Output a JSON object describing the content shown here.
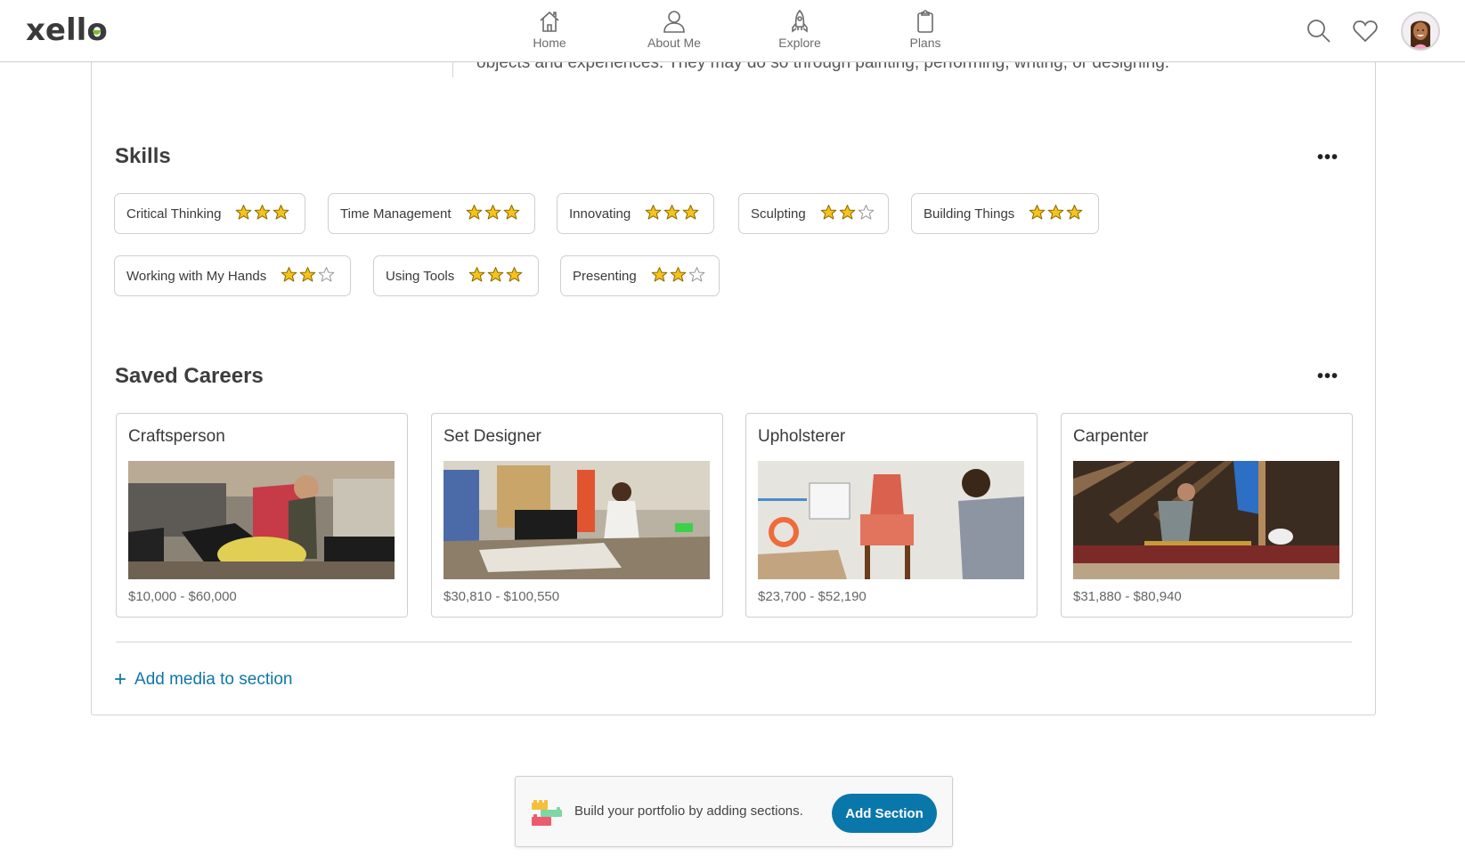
{
  "header": {
    "logo": "xello",
    "nav": [
      {
        "label": "Home",
        "icon": "home-icon"
      },
      {
        "label": "About Me",
        "icon": "person-icon"
      },
      {
        "label": "Explore",
        "icon": "rocket-icon"
      },
      {
        "label": "Plans",
        "icon": "clipboard-icon"
      }
    ],
    "actions": [
      "search-icon",
      "heart-icon",
      "avatar"
    ]
  },
  "about": {
    "text_fragment": "objects and experiences. They may do so through painting, performing, writing, or designing."
  },
  "skills": {
    "title": "Skills",
    "more_label": "•••",
    "items": [
      {
        "label": "Critical Thinking",
        "rating": 3,
        "max": 3
      },
      {
        "label": "Time Management",
        "rating": 3,
        "max": 3
      },
      {
        "label": "Innovating",
        "rating": 3,
        "max": 3
      },
      {
        "label": "Sculpting",
        "rating": 2,
        "max": 3
      },
      {
        "label": "Building Things",
        "rating": 3,
        "max": 3
      },
      {
        "label": "Working with My Hands",
        "rating": 2,
        "max": 3
      },
      {
        "label": "Using Tools",
        "rating": 3,
        "max": 3
      },
      {
        "label": "Presenting",
        "rating": 2,
        "max": 3
      }
    ]
  },
  "saved_careers": {
    "title": "Saved Careers",
    "more_label": "•••",
    "items": [
      {
        "title": "Craftsperson",
        "salary": "$10,000 - $60,000"
      },
      {
        "title": "Set Designer",
        "salary": "$30,810 - $100,550"
      },
      {
        "title": "Upholsterer",
        "salary": "$23,700 - $52,190"
      },
      {
        "title": "Carpenter",
        "salary": "$31,880 - $80,940"
      }
    ],
    "add_media_label": "Add media to section"
  },
  "bottom_bar": {
    "text": "Build your portfolio by adding sections.",
    "button_label": "Add Section"
  },
  "colors": {
    "accent": "#0a77aa",
    "link": "#0f76a8",
    "star": "#f6c21c",
    "logo_dot": "#7dbb2d"
  }
}
